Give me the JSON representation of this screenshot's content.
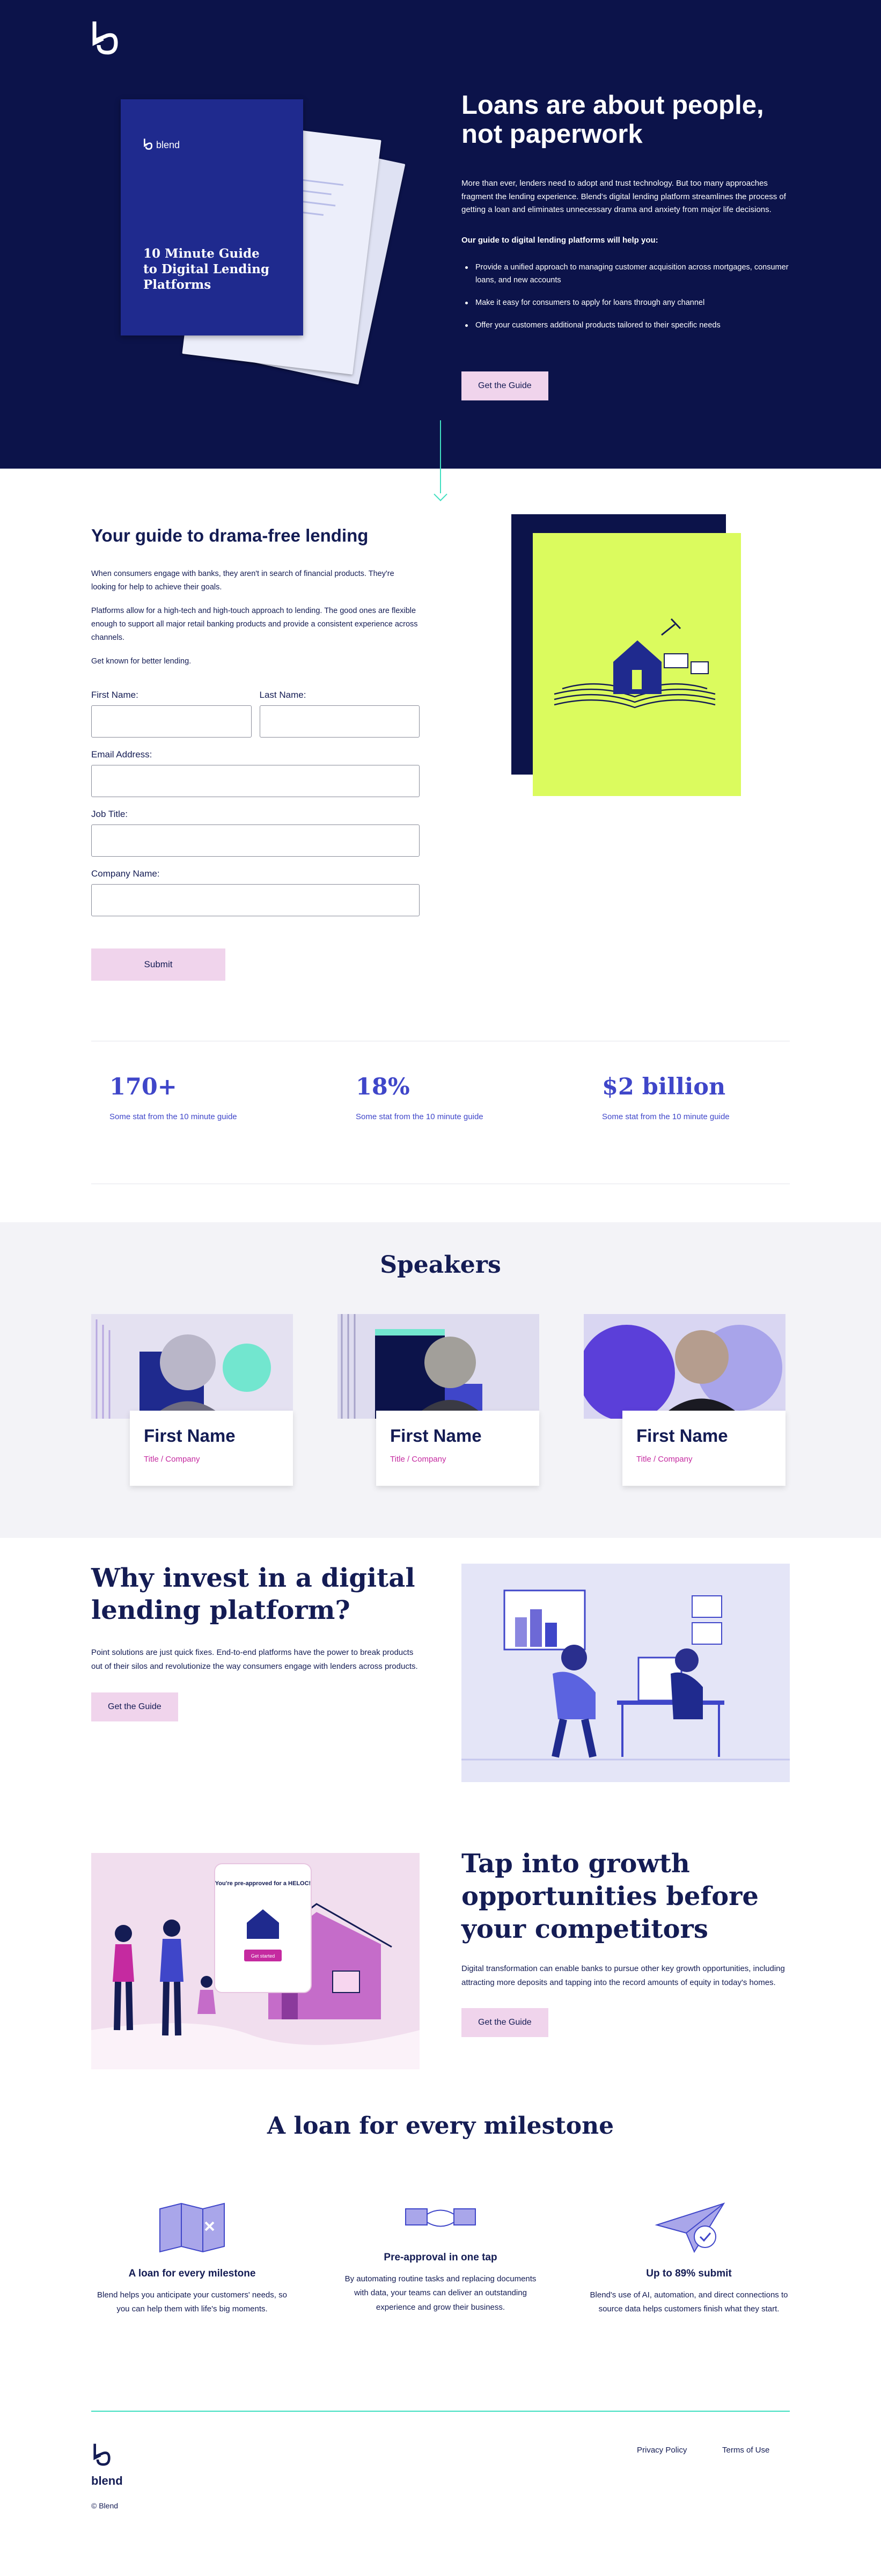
{
  "brand": {
    "name": "blend",
    "copyright": "© Blend"
  },
  "hero": {
    "book_brand": "blend",
    "book_title": "10 Minute Guide to Digital Lending Platforms",
    "title": "Loans are about people, not paperwork",
    "intro": "More than ever, lenders need to adopt and trust technology. But too many approaches fragment the lending experience. Blend's digital lending platform streamlines the process of getting a loan and eliminates unnecessary drama and anxiety from major life decisions.",
    "subheading": "Our guide to digital lending platforms will help you:",
    "bullets": [
      "Provide a unified approach to managing customer acquisition across mortgages, consumer loans, and new accounts",
      "Make it easy for consumers to apply for loans through any channel",
      "Offer your customers additional products tailored to their specific needs"
    ],
    "cta": "Get the Guide"
  },
  "form": {
    "title": "Your guide to drama-free lending",
    "para1": "When consumers engage with banks, they aren't in search of financial products. They're looking for help to achieve their goals.",
    "para2": "Platforms allow for a high-tech and high-touch approach to lending. The good ones are flexible enough to support all major retail banking products and provide a consistent experience across channels.",
    "para3": "Get known for better lending.",
    "first_name": "First Name:",
    "last_name": "Last Name:",
    "email": "Email Address:",
    "job_title": "Job Title:",
    "company": "Company Name:",
    "submit": "Submit"
  },
  "stats": [
    {
      "value": "170+",
      "caption": "Some stat from the 10 minute guide"
    },
    {
      "value": "18%",
      "caption": "Some stat from the 10 minute guide"
    },
    {
      "value": "$2 billion",
      "caption": "Some stat from the 10 minute guide"
    }
  ],
  "speakers": {
    "title": "Speakers",
    "items": [
      {
        "name": "First Name",
        "role": "Title / Company"
      },
      {
        "name": "First Name",
        "role": "Title / Company"
      },
      {
        "name": "First Name",
        "role": "Title / Company"
      }
    ]
  },
  "why": {
    "title": "Why invest in a digital lending platform?",
    "body": "Point solutions are just quick fixes. End-to-end platforms have the power to break products out of their silos and revolutionize the way consumers engage with lenders across products.",
    "cta": "Get the Guide"
  },
  "tap": {
    "title": "Tap into growth opportunities before your competitors",
    "body": "Digital transformation can enable banks to pursue other key growth opportunities, including attracting more deposits and tapping into the record amounts of equity in today's homes.",
    "cta": "Get the Guide",
    "phone_text": "You're pre-approved for a HELOC!",
    "phone_btn": "Get started"
  },
  "milestone": {
    "title": "A loan for every milestone",
    "features": [
      {
        "title": "A loan for every milestone",
        "body": "Blend helps you anticipate your customers' needs, so you can help them with life's big moments."
      },
      {
        "title": "Pre-approval in one tap",
        "body": "By automating routine tasks and replacing documents with data, your teams can deliver an outstanding experience and grow their business."
      },
      {
        "title": "Up to 89% submit",
        "body": "Blend's use of AI, automation, and direct connections to source data helps customers finish what they start."
      }
    ]
  },
  "footer": {
    "privacy": "Privacy Policy",
    "terms": "Terms of Use"
  },
  "colors": {
    "navy": "#0c134a",
    "pink": "#f0d4ec",
    "lime": "#dbfb5e",
    "teal": "#41dfc0",
    "accent": "#3f46c9"
  }
}
